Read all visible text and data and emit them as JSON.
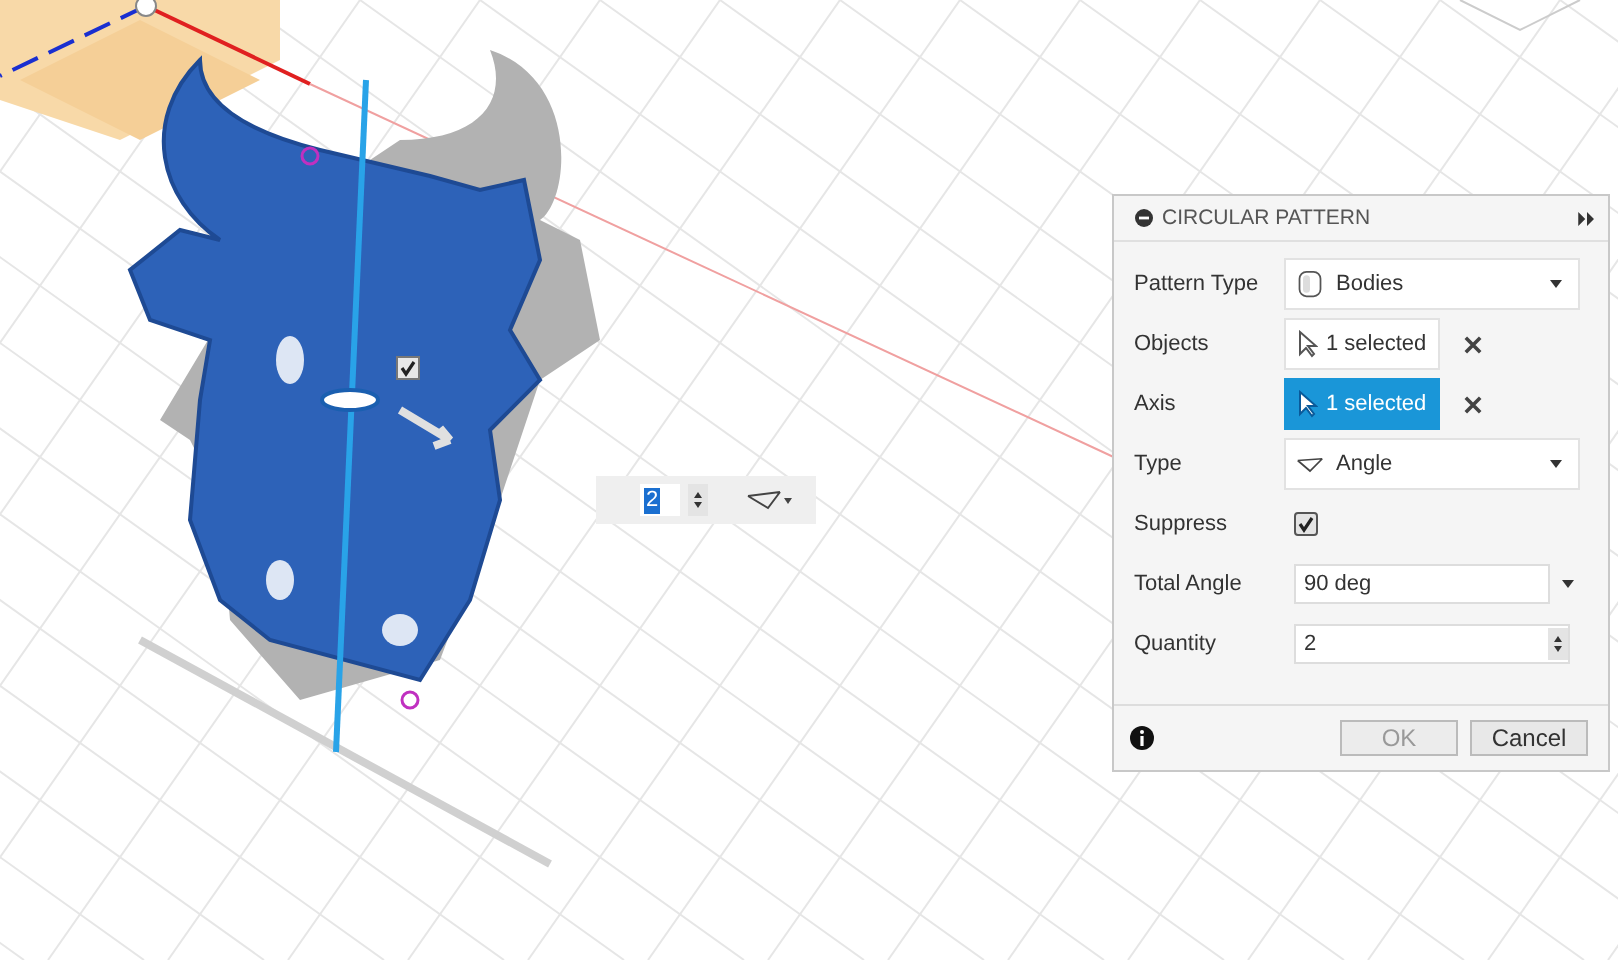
{
  "canvas": {
    "quantity_field": {
      "value": "2"
    },
    "suppress_toggle": {
      "checked": true
    }
  },
  "dialog": {
    "title": "CIRCULAR PATTERN",
    "rows": [
      {
        "kind": "bodies-dropdown",
        "label": "Pattern Type",
        "value": "Bodies"
      },
      {
        "kind": "selection",
        "label": "Objects",
        "value": "1 selected",
        "selected": false
      },
      {
        "kind": "selection",
        "label": "Axis",
        "value": "1 selected",
        "selected": true
      },
      {
        "kind": "angle-dropdown",
        "label": "Type",
        "value": "Angle"
      },
      {
        "kind": "checkbox",
        "label": "Suppress",
        "checked": true
      },
      {
        "kind": "combo",
        "label": "Total Angle",
        "value": "90 deg"
      },
      {
        "kind": "spinner",
        "label": "Quantity",
        "value": "2"
      }
    ],
    "buttons": [
      {
        "label": "OK",
        "disabled": true
      },
      {
        "label": "Cancel",
        "disabled": false
      }
    ]
  }
}
